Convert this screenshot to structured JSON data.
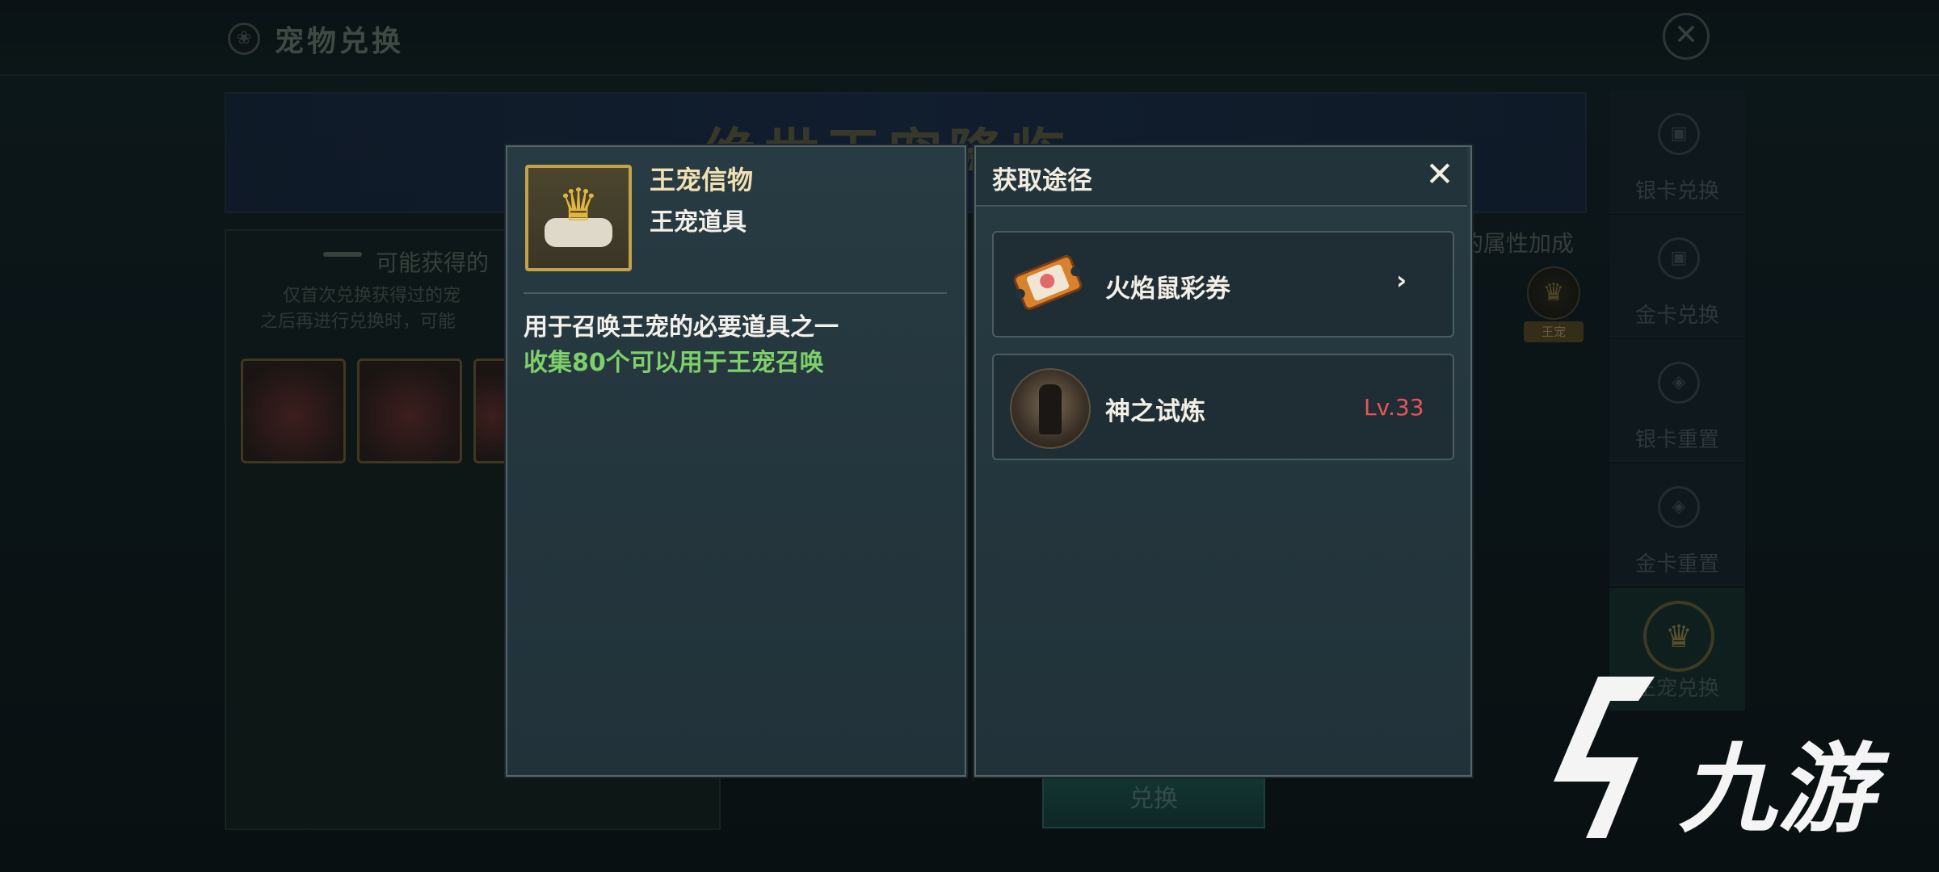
{
  "background": {
    "title": "宠物兑换",
    "banner_text": "绝世王宠降临",
    "left_panel": {
      "heading": "可能获得的",
      "note_line1": "仅首次兑换获得过的宠",
      "note_line2": "之后再进行兑换时，可能"
    },
    "attribute_bonus": "的属性加成",
    "crown_badge_label": "王宠",
    "exchange_button": "兑换",
    "side_nav": [
      {
        "label": "银卡兑换",
        "icon": "silver-card-icon"
      },
      {
        "label": "金卡兑换",
        "icon": "gold-card-icon"
      },
      {
        "label": "银卡重置",
        "icon": "silver-card-reset-icon"
      },
      {
        "label": "金卡重置",
        "icon": "gold-card-reset-icon"
      },
      {
        "label": "王宠兑换",
        "icon": "crown-icon",
        "active": true
      }
    ]
  },
  "item": {
    "name": "王宠信物",
    "type": "王宠道具",
    "description": "用于召唤王宠的必要道具之一",
    "hint": "收集80个可以用于王宠召唤"
  },
  "source": {
    "title": "获取途径",
    "rows": [
      {
        "label": "火焰鼠彩券",
        "icon": "lottery-ticket-icon",
        "action": "chevron-right-icon"
      },
      {
        "label": "神之试炼",
        "icon": "god-trial-icon",
        "level": "Lv.33"
      }
    ]
  },
  "watermark": {
    "text": "九游"
  },
  "colors": {
    "hint_green": "#7dd06a",
    "level_red": "#e5555d",
    "gold_border": "#c4a24a",
    "item_name": "#f0e0b2"
  }
}
